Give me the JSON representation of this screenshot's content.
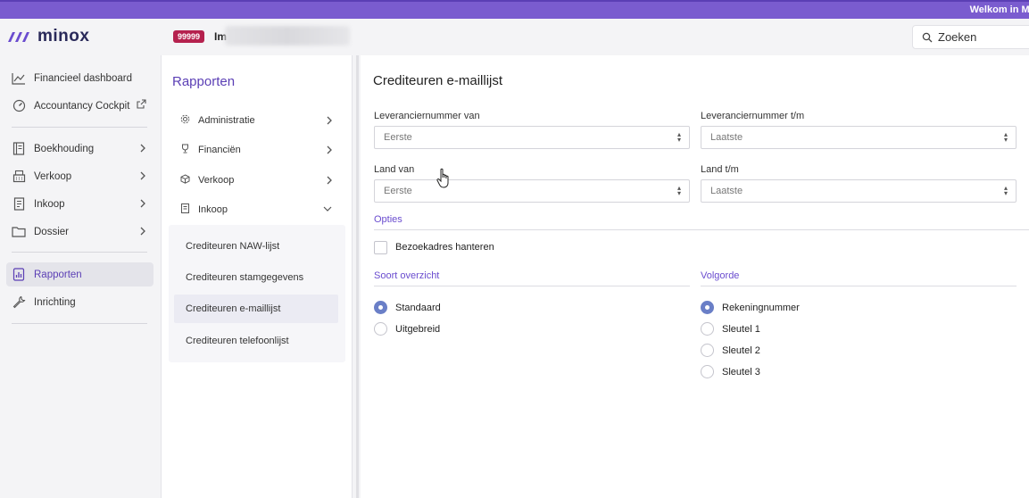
{
  "banner": {
    "text": "Welkom in Mir"
  },
  "header": {
    "logo_text": "minox",
    "client_badge": "99999",
    "client_name": "Im",
    "search_placeholder": "Zoeken"
  },
  "sidebar": {
    "items": [
      {
        "label": "Financieel dashboard",
        "icon": "chart-icon"
      },
      {
        "label": "Accountancy Cockpit",
        "icon": "gauge-icon",
        "external": true
      },
      {
        "label": "Boekhouding",
        "icon": "ledger-icon"
      },
      {
        "label": "Verkoop",
        "icon": "register-icon"
      },
      {
        "label": "Inkoop",
        "icon": "receipt-icon"
      },
      {
        "label": "Dossier",
        "icon": "folder-icon"
      },
      {
        "label": "Rapporten",
        "icon": "report-icon",
        "active": true
      },
      {
        "label": "Inrichting",
        "icon": "wrench-icon"
      }
    ]
  },
  "reports_panel": {
    "title": "Rapporten",
    "categories": [
      {
        "label": "Administratie",
        "icon": "gear-icon"
      },
      {
        "label": "Financiën",
        "icon": "trophy-icon"
      },
      {
        "label": "Verkoop",
        "icon": "box-icon"
      },
      {
        "label": "Inkoop",
        "icon": "receipt-icon",
        "expanded": true
      }
    ],
    "inkoop_items": [
      {
        "label": "Crediteuren NAW-lijst"
      },
      {
        "label": "Crediteuren stamgegevens"
      },
      {
        "label": "Crediteuren e-maillijst",
        "active": true
      },
      {
        "label": "Crediteuren telefoonlijst"
      }
    ]
  },
  "form": {
    "title": "Crediteuren e-maillijst",
    "supplier_from": {
      "label": "Leveranciernummer van",
      "value": "Eerste"
    },
    "supplier_to": {
      "label": "Leveranciernummer t/m",
      "value": "Laatste"
    },
    "country_from": {
      "label": "Land van",
      "value": "Eerste"
    },
    "country_to": {
      "label": "Land t/m",
      "value": "Laatste"
    },
    "options_title": "Opties",
    "visit_address_label": "Bezoekadres hanteren",
    "overview_title": "Soort overzicht",
    "overview_options": [
      "Standaard",
      "Uitgebreid"
    ],
    "overview_selected": "Standaard",
    "order_title": "Volgorde",
    "order_options": [
      "Rekeningnummer",
      "Sleutel 1",
      "Sleutel 2",
      "Sleutel 3"
    ],
    "order_selected": "Rekeningnummer"
  },
  "colors": {
    "accent": "#5b3fb5",
    "banner": "#7a5ccf",
    "badge": "#b5214e",
    "radio_on": "#6a7fc7"
  }
}
